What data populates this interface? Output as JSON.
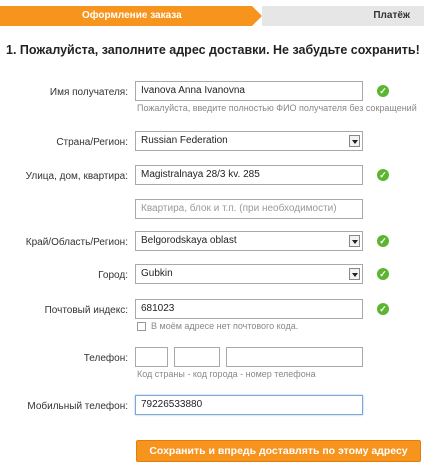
{
  "steps": {
    "active": "Оформление заказа",
    "next": "Платёж"
  },
  "title": "1. Пожалуйста, заполните адрес доставки. Не забудьте сохранить!",
  "form": {
    "recipient": {
      "label": "Имя получателя:",
      "value": "Ivanova Anna Ivanovna",
      "hint": "Пожалуйста, введите полностью ФИО получателя без сокращений"
    },
    "country": {
      "label": "Страна/Регион:",
      "value": "Russian Federation"
    },
    "street": {
      "label": "Улица, дом, квартира:",
      "value": "Magistralnaya 28/3 kv. 285",
      "placeholder2": "Квартира, блок и т.п. (при необходимости)"
    },
    "region": {
      "label": "Край/Область/Регион:",
      "value": "Belgorodskaya oblast"
    },
    "city": {
      "label": "Город:",
      "value": "Gubkin"
    },
    "zip": {
      "label": "Почтовый индекс:",
      "value": "681023",
      "no_zip_label": "В моём адресе нет почтового кода."
    },
    "phone": {
      "label": "Телефон:",
      "hint": "Код страны - код города - номер телефона"
    },
    "mobile": {
      "label": "Мобильный телефон:",
      "value": "79226533880"
    }
  },
  "save_button": "Сохранить и впредь доставлять по этому адресу",
  "colors": {
    "accent": "#f7941d",
    "valid": "#5cb531"
  },
  "icons": {
    "valid": "check-circle-icon",
    "dropdown": "chevron-down-icon"
  }
}
